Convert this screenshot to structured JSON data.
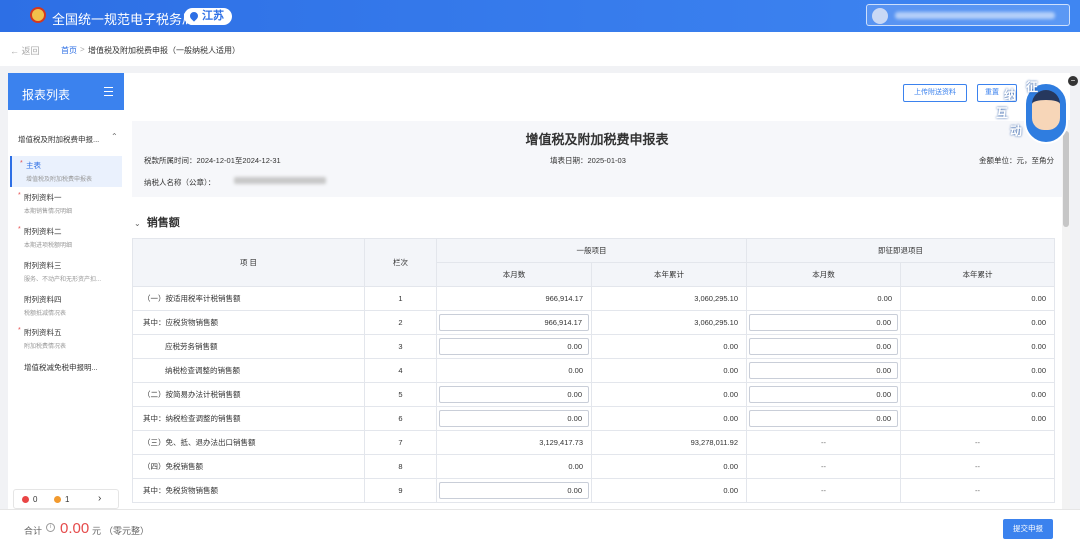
{
  "header": {
    "site_title": "全国统一规范电子税务局",
    "region": "江苏"
  },
  "breadcrumb": {
    "back": "返回",
    "home": "首页",
    "separator": ">",
    "current": "增值税及附加税费申报（一般纳税人适用）"
  },
  "sidebar": {
    "title": "报表列表",
    "group": "增值税及附加税费申报...",
    "items": [
      {
        "label": "主表",
        "sub": "增值税及附加税费申报表",
        "required": true,
        "active": true
      },
      {
        "label": "附列资料一",
        "sub": "本期销售情况明细",
        "required": true
      },
      {
        "label": "附列资料二",
        "sub": "本期进项税额明细",
        "required": true
      },
      {
        "label": "附列资料三",
        "sub": "服务、不动产和无形资产扣...",
        "required": false
      },
      {
        "label": "附列资料四",
        "sub": "税额抵减情况表",
        "required": false
      },
      {
        "label": "附列资料五",
        "sub": "附加税费情况表",
        "required": true
      },
      {
        "label": "增值税减免税申报明...",
        "sub": "",
        "required": false
      }
    ],
    "footer": {
      "error_count": "0",
      "warning_count": "1"
    }
  },
  "toolbar": {
    "upload_label": "上传附送资料",
    "reset_label": "重置"
  },
  "form": {
    "title": "增值税及附加税费申报表",
    "period": "税款所属时间：2024-12-01至2024-12-31",
    "fill_date": "填表日期：2025-01-03",
    "unit": "金额单位：元，至角分",
    "taxpayer_label": "纳税人名称（公章）："
  },
  "section": {
    "title": "销售额"
  },
  "table": {
    "headers": {
      "item": "项 目",
      "line": "栏次",
      "general": "一般项目",
      "refund": "即征即退项目",
      "month": "本月数",
      "year": "本年累计"
    },
    "rows": [
      {
        "name": "（一）按适用税率计税销售额",
        "line": "1",
        "g_month": "966,914.17",
        "g_year": "3,060,295.10",
        "r_month": "0.00",
        "r_year": "0.00",
        "g_input": false,
        "r_input": false,
        "indent": false
      },
      {
        "name": "其中：应税货物销售额",
        "line": "2",
        "g_month": "966,914.17",
        "g_year": "3,060,295.10",
        "r_month": "0.00",
        "r_year": "0.00",
        "g_input": true,
        "r_input": true,
        "indent": false
      },
      {
        "name": "应税劳务销售额",
        "line": "3",
        "g_month": "0.00",
        "g_year": "0.00",
        "r_month": "0.00",
        "r_year": "0.00",
        "g_input": true,
        "r_input": true,
        "indent": true
      },
      {
        "name": "纳税检查调整的销售额",
        "line": "4",
        "g_month": "0.00",
        "g_year": "0.00",
        "r_month": "0.00",
        "r_year": "0.00",
        "g_input": false,
        "r_input": true,
        "indent": true
      },
      {
        "name": "（二）按简易办法计税销售额",
        "line": "5",
        "g_month": "0.00",
        "g_year": "0.00",
        "r_month": "0.00",
        "r_year": "0.00",
        "g_input": true,
        "r_input": true,
        "indent": false
      },
      {
        "name": "其中：纳税检查调整的销售额",
        "line": "6",
        "g_month": "0.00",
        "g_year": "0.00",
        "r_month": "0.00",
        "r_year": "0.00",
        "g_input": true,
        "r_input": true,
        "indent": false
      },
      {
        "name": "（三）免、抵、退办法出口销售额",
        "line": "7",
        "g_month": "3,129,417.73",
        "g_year": "93,278,011.92",
        "r_month": "--",
        "r_year": "--",
        "g_input": false,
        "r_input": false,
        "indent": false
      },
      {
        "name": "（四）免税销售额",
        "line": "8",
        "g_month": "0.00",
        "g_year": "0.00",
        "r_month": "--",
        "r_year": "--",
        "g_input": false,
        "r_input": false,
        "indent": false
      },
      {
        "name": "其中：免税货物销售额",
        "line": "9",
        "g_month": "0.00",
        "g_year": "0.00",
        "r_month": "--",
        "r_year": "--",
        "g_input": true,
        "r_input": false,
        "indent": false
      }
    ]
  },
  "assistant": {
    "chars": [
      "征",
      "纳",
      "互",
      "动"
    ]
  },
  "footer": {
    "total_label": "合计",
    "total_value": "0.00",
    "total_unit": "元",
    "total_words": "（零元整）",
    "submit_label": "提交申报"
  },
  "colors": {
    "primary": "#3b82ee",
    "header": "#2d6fe5",
    "error": "#e94545",
    "warning": "#f29a2e",
    "total": "#e54b4b"
  }
}
